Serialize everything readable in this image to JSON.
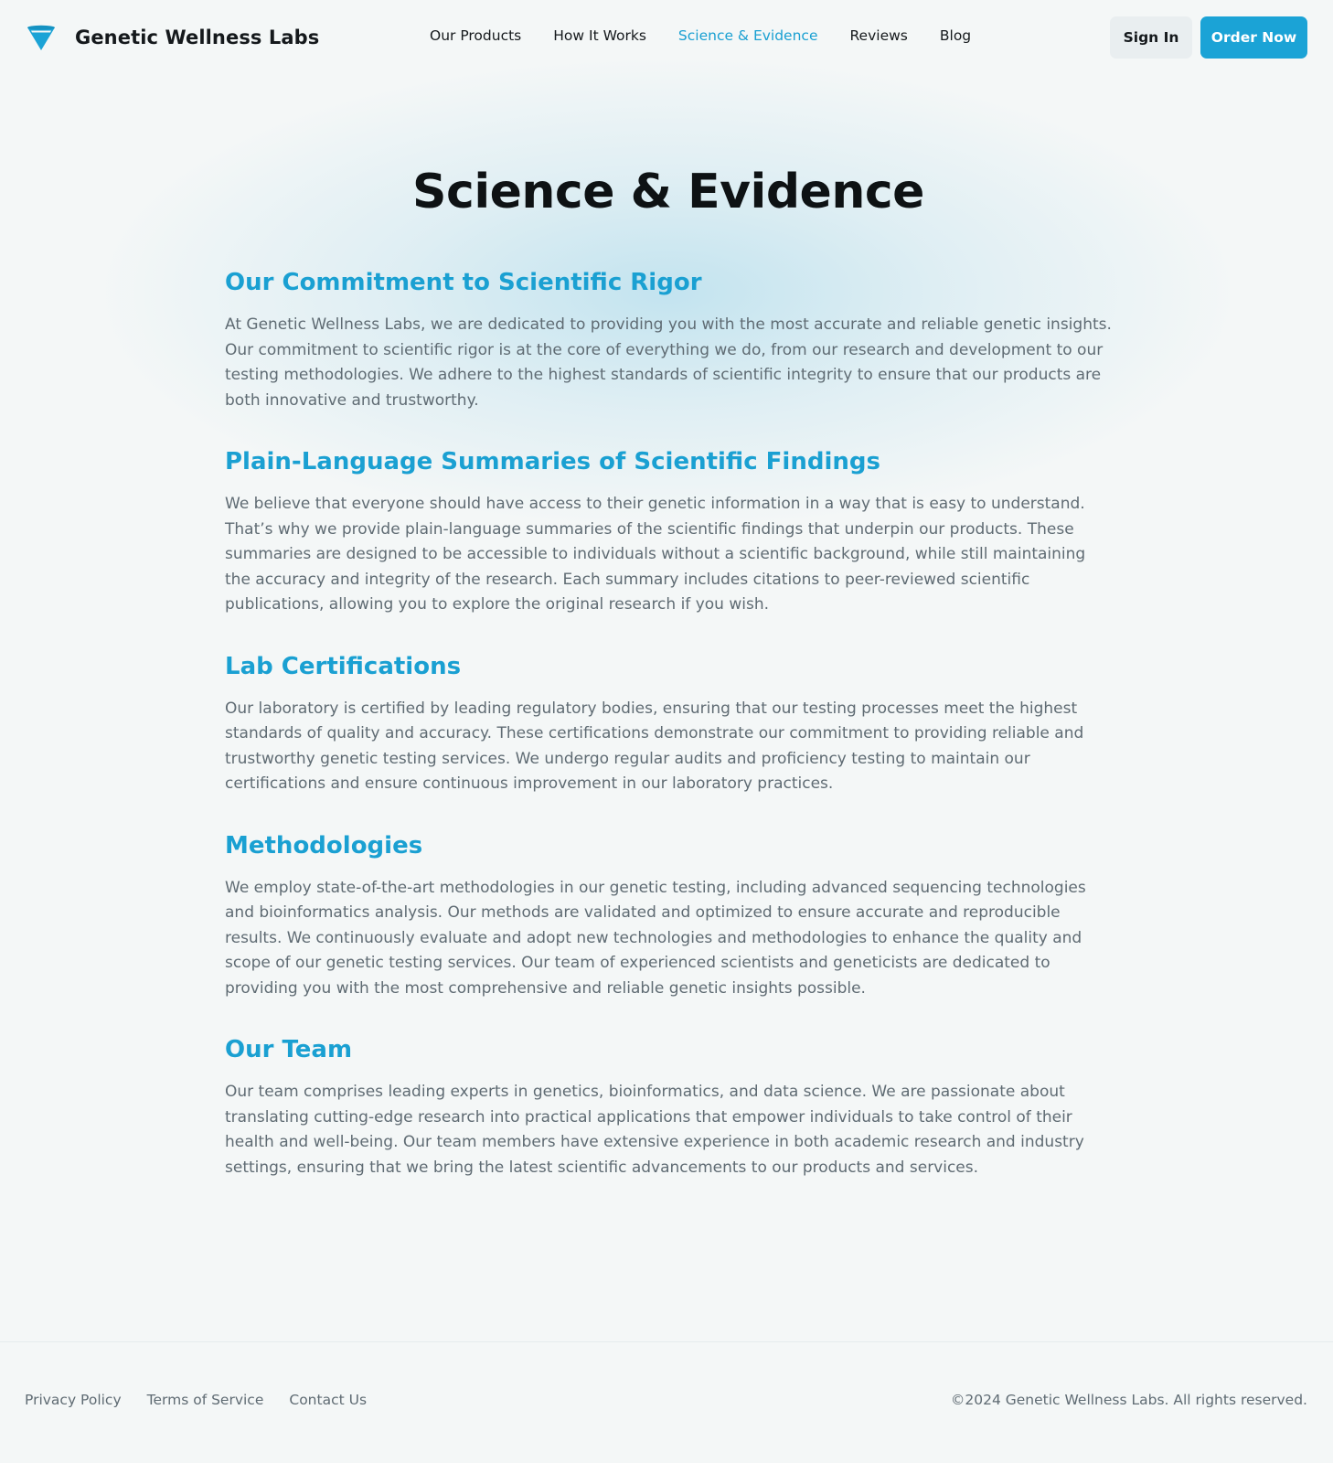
{
  "brand": {
    "name": "Genetic Wellness Labs",
    "logo_icon": "funnel-logo-icon",
    "accent": "#1ba3d6"
  },
  "nav": {
    "items": [
      {
        "label": "Our Products"
      },
      {
        "label": "How It Works"
      },
      {
        "label": "Science & Evidence",
        "active": true
      },
      {
        "label": "Reviews"
      },
      {
        "label": "Blog"
      }
    ],
    "sign_in": "Sign In",
    "order_now": "Order Now"
  },
  "page": {
    "title": "Science & Evidence",
    "sections": [
      {
        "heading": "Our Commitment to Scientific Rigor",
        "body": "At Genetic Wellness Labs, we are dedicated to providing you with the most accurate and reliable genetic insights. Our commitment to scientific rigor is at the core of everything we do, from our research and development to our testing methodologies. We adhere to the highest standards of scientific integrity to ensure that our products are both innovative and trustworthy."
      },
      {
        "heading": "Plain-Language Summaries of Scientific Findings",
        "body": "We believe that everyone should have access to their genetic information in a way that is easy to understand. That’s why we provide plain-language summaries of the scientific findings that underpin our products. These summaries are designed to be accessible to individuals without a scientific background, while still maintaining the accuracy and integrity of the research. Each summary includes citations to peer-reviewed scientific publications, allowing you to explore the original research if you wish."
      },
      {
        "heading": "Lab Certifications",
        "body": "Our laboratory is certified by leading regulatory bodies, ensuring that our testing processes meet the highest standards of quality and accuracy. These certifications demonstrate our commitment to providing reliable and trustworthy genetic testing services. We undergo regular audits and proficiency testing to maintain our certifications and ensure continuous improvement in our laboratory practices."
      },
      {
        "heading": "Methodologies",
        "body": "We employ state-of-the-art methodologies in our genetic testing, including advanced sequencing technologies and bioinformatics analysis. Our methods are validated and optimized to ensure accurate and reproducible results. We continuously evaluate and adopt new technologies and methodologies to enhance the quality and scope of our genetic testing services. Our team of experienced scientists and geneticists are dedicated to providing you with the most comprehensive and reliable genetic insights possible."
      },
      {
        "heading": "Our Team",
        "body": "Our team comprises leading experts in genetics, bioinformatics, and data science. We are passionate about translating cutting-edge research into practical applications that empower individuals to take control of their health and well-being. Our team members have extensive experience in both academic research and industry settings, ensuring that we bring the latest scientific advancements to our products and services."
      }
    ]
  },
  "footer": {
    "links": [
      {
        "label": "Privacy Policy"
      },
      {
        "label": "Terms of Service"
      },
      {
        "label": "Contact Us"
      }
    ],
    "copyright": "©2024 Genetic Wellness Labs. All rights reserved."
  }
}
